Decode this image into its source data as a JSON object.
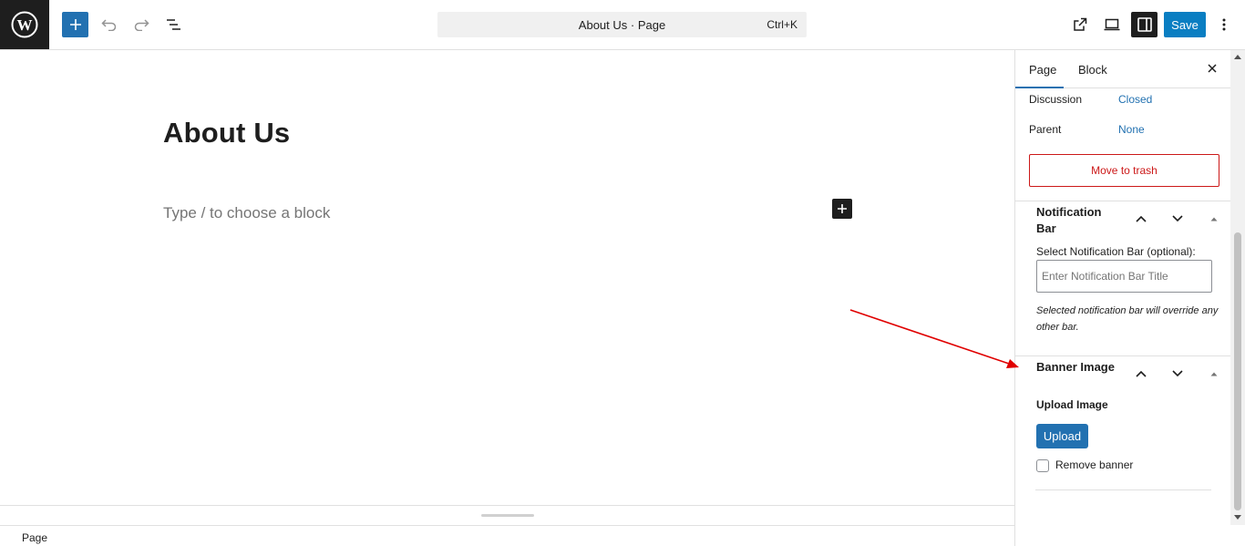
{
  "toolbar": {
    "add_icon": "plus-icon",
    "undo_icon": "undo-icon",
    "redo_icon": "redo-icon",
    "list_view_icon": "list-view-icon",
    "command_title": "About Us · Page",
    "command_shortcut": "Ctrl+K",
    "view_icon": "external-link-icon",
    "device_icon": "desktop-icon",
    "settings_icon": "sidebar-icon",
    "save_label": "Save",
    "more_icon": "more-vertical-icon"
  },
  "editor": {
    "title": "About Us",
    "block_placeholder": "Type / to choose a block"
  },
  "footer": {
    "breadcrumb": "Page"
  },
  "sidebar": {
    "tabs": [
      {
        "label": "Page",
        "active": true
      },
      {
        "label": "Block",
        "active": false
      }
    ],
    "discussion_label": "Discussion",
    "discussion_value": "Closed",
    "parent_label": "Parent",
    "parent_value": "None",
    "trash_label": "Move to trash",
    "notification_bar": {
      "title": "Notification Bar",
      "select_label": "Select Notification Bar (optional):",
      "input_placeholder": "Enter Notification Bar Title",
      "note": "Selected notification bar will override any other bar."
    },
    "banner_image": {
      "title": "Banner Image",
      "upload_label": "Upload Image",
      "upload_button": "Upload",
      "remove_label": "Remove banner",
      "remove_checked": false
    }
  },
  "colors": {
    "accent": "#2271b1",
    "save": "#0a7ec2",
    "danger": "#cc1818",
    "annotation_arrow": "#e00000"
  }
}
